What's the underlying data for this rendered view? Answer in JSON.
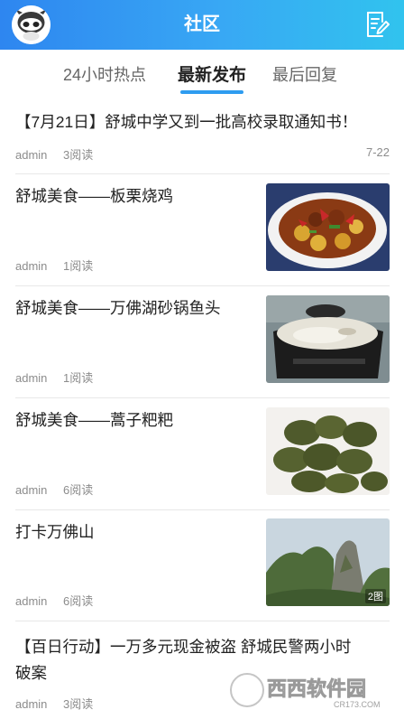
{
  "header": {
    "title": "社区",
    "avatar_icon": "robot-mascot-icon",
    "compose_icon": "edit-note-icon"
  },
  "tabs": [
    {
      "label": "24小时热点"
    },
    {
      "label": "最新发布"
    },
    {
      "label": "最后回复"
    }
  ],
  "active_tab": "最新发布",
  "posts": [
    {
      "title": "【7月21日】舒城中学又到一批高校录取通知书！",
      "author": "admin",
      "reads": "3阅读",
      "date": "7-22"
    },
    {
      "title": "舒城美食——板栗烧鸡",
      "author": "admin",
      "reads": "1阅读"
    },
    {
      "title": "舒城美食——万佛湖砂锅鱼头",
      "author": "admin",
      "reads": "1阅读"
    },
    {
      "title": "舒城美食——蒿子粑粑",
      "author": "admin",
      "reads": "6阅读"
    },
    {
      "title": "打卡万佛山",
      "author": "admin",
      "reads": "6阅读",
      "image_count": "2图"
    },
    {
      "title_line1": "【百日行动】一万多元现金被盗 舒城民警两小时",
      "title_line2": "破案",
      "author": "admin",
      "reads": "3阅读"
    }
  ],
  "watermark": {
    "brand": "西西软件园",
    "url": "CR173.COM"
  },
  "colors": {
    "header_start": "#2e86f0",
    "header_end": "#31c3ee",
    "tab_underline": "#2e9cf0"
  }
}
